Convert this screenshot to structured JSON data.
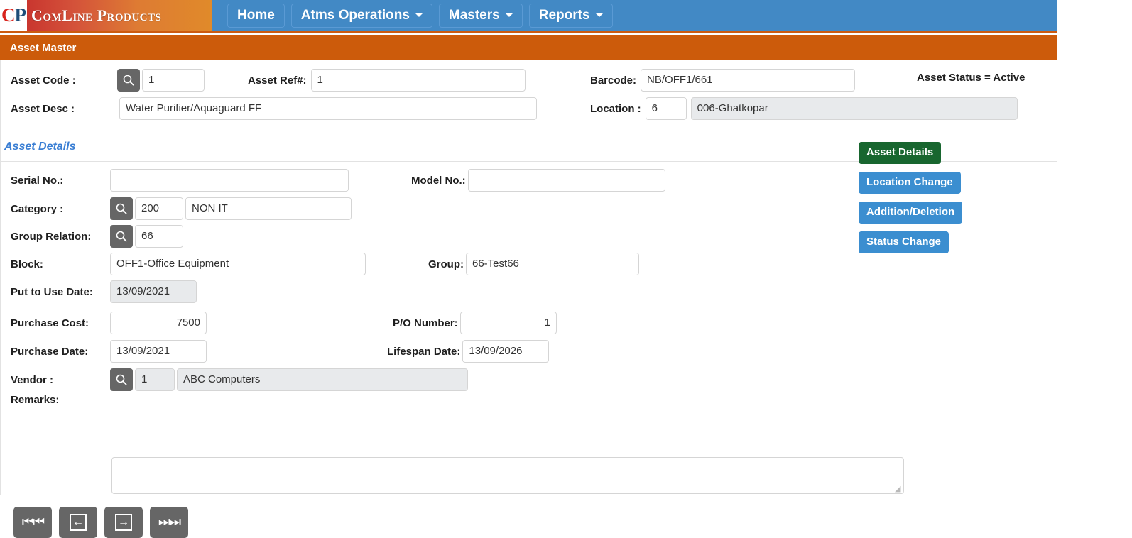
{
  "brand": {
    "mark_c": "C",
    "mark_p": "P",
    "name": "ComLine Products"
  },
  "nav": {
    "items": [
      {
        "label": "Home",
        "has_caret": false
      },
      {
        "label": "Atms Operations",
        "has_caret": true
      },
      {
        "label": "Masters",
        "has_caret": true
      },
      {
        "label": "Reports",
        "has_caret": true
      }
    ]
  },
  "page": {
    "title": "Asset Master",
    "section_title": "Asset Details"
  },
  "header_form": {
    "asset_code_label": "Asset Code :",
    "asset_code_value": "1",
    "asset_ref_label": "Asset Ref#:",
    "asset_ref_value": "1",
    "barcode_label": "Barcode:",
    "barcode_value": "NB/OFF1/661",
    "asset_status": "Asset Status = Active",
    "asset_desc_label": "Asset Desc :",
    "asset_desc_value": "Water Purifier/Aquaguard FF",
    "location_label": "Location :",
    "location_code": "6",
    "location_name": "006-Ghatkopar"
  },
  "details_form": {
    "serial_no_label": "Serial No.:",
    "serial_no_value": "",
    "model_no_label": "Model No.:",
    "model_no_value": "",
    "category_label": "Category :",
    "category_code": "200",
    "category_name": "NON IT",
    "group_relation_label": "Group Relation:",
    "group_relation_value": "66",
    "block_label": "Block:",
    "block_value": "OFF1-Office Equipment",
    "group_label": "Group:",
    "group_value": "66-Test66",
    "put_to_use_label": "Put to Use Date:",
    "put_to_use_value": "13/09/2021",
    "purchase_cost_label": "Purchase Cost:",
    "purchase_cost_value": "7500",
    "po_number_label": "P/O Number:",
    "po_number_value": "1",
    "purchase_date_label": "Purchase Date:",
    "purchase_date_value": "13/09/2021",
    "lifespan_date_label": "Lifespan Date:",
    "lifespan_date_value": "13/09/2026",
    "vendor_label": "Vendor :",
    "vendor_code": "1",
    "vendor_name": "ABC Computers",
    "remarks_label": "Remarks:",
    "remarks_value": ""
  },
  "side_buttons": [
    {
      "label": "Asset Details",
      "state": "active"
    },
    {
      "label": "Location Change",
      "state": "normal"
    },
    {
      "label": "Addition/Deletion",
      "state": "normal"
    },
    {
      "label": "Status Change",
      "state": "normal"
    }
  ],
  "pager": {
    "first_label": "⏮⏮",
    "prev_label": "←",
    "next_label": "→",
    "last_label": "⏭⏭"
  },
  "colors": {
    "nav_blue": "#4289c5",
    "title_orange": "#cc5b0b",
    "active_green": "#18662f",
    "button_blue": "#3b8ed0",
    "section_link_blue": "#3b7fd4",
    "icon_gray": "#666666"
  }
}
